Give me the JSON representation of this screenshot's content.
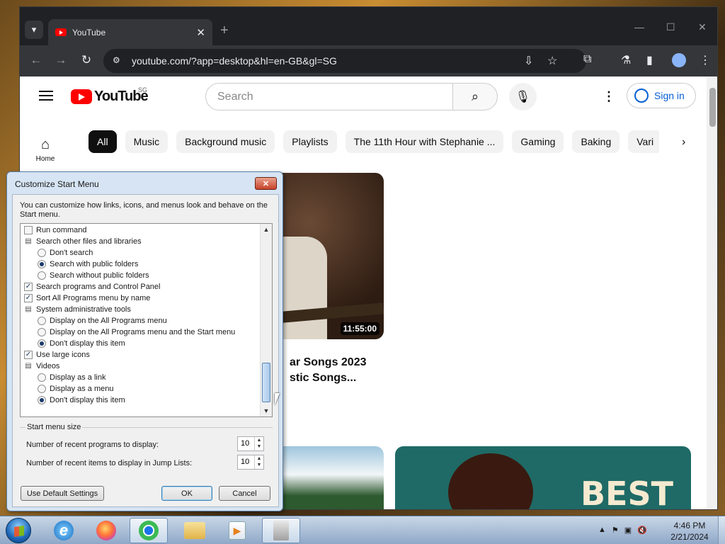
{
  "browser": {
    "tab_title": "YouTube",
    "url": "youtube.com/?app=desktop&hl=en-GB&gl=SG"
  },
  "youtube": {
    "logo_text": "YouTube",
    "region": "SG",
    "search_placeholder": "Search",
    "signin_label": "Sign in",
    "home_label": "Home",
    "chips": [
      "All",
      "Music",
      "Background music",
      "Playlists",
      "The 11th Hour with Stephanie ...",
      "Gaming",
      "Baking",
      "Vari"
    ],
    "video1_duration": "11:55:00",
    "video1_title_line1": "ar Songs 2023",
    "video1_title_line2": "stic Songs...",
    "thumb3_text": "BEST"
  },
  "dialog": {
    "title": "Customize Start Menu",
    "intro": "You can customize how links, icons, and menus look and behave on the Start menu.",
    "options": [
      {
        "kind": "checkbox",
        "checked": false,
        "indent": 0,
        "label": "Run command"
      },
      {
        "kind": "group",
        "indent": 0,
        "label": "Search other files and libraries"
      },
      {
        "kind": "radio",
        "checked": false,
        "indent": 1,
        "label": "Don't search"
      },
      {
        "kind": "radio",
        "checked": true,
        "indent": 1,
        "label": "Search with public folders"
      },
      {
        "kind": "radio",
        "checked": false,
        "indent": 1,
        "label": "Search without public folders"
      },
      {
        "kind": "checkbox",
        "checked": true,
        "indent": 0,
        "label": "Search programs and Control Panel"
      },
      {
        "kind": "checkbox",
        "checked": true,
        "indent": 0,
        "label": "Sort All Programs menu by name"
      },
      {
        "kind": "group",
        "indent": 0,
        "label": "System administrative tools"
      },
      {
        "kind": "radio",
        "checked": false,
        "indent": 1,
        "label": "Display on the All Programs menu"
      },
      {
        "kind": "radio",
        "checked": false,
        "indent": 1,
        "label": "Display on the All Programs menu and the Start menu"
      },
      {
        "kind": "radio",
        "checked": true,
        "indent": 1,
        "label": "Don't display this item"
      },
      {
        "kind": "checkbox",
        "checked": true,
        "indent": 0,
        "label": "Use large icons"
      },
      {
        "kind": "group",
        "indent": 0,
        "label": "Videos"
      },
      {
        "kind": "radio",
        "checked": false,
        "indent": 1,
        "label": "Display as a link"
      },
      {
        "kind": "radio",
        "checked": false,
        "indent": 1,
        "label": "Display as a menu"
      },
      {
        "kind": "radio",
        "checked": true,
        "indent": 1,
        "label": "Don't display this item"
      }
    ],
    "size_group_label": "Start menu size",
    "recent_programs_label": "Number of recent programs to display:",
    "recent_programs_value": "10",
    "recent_items_label": "Number of recent items to display in Jump Lists:",
    "recent_items_value": "10",
    "default_button": "Use Default Settings",
    "ok_button": "OK",
    "cancel_button": "Cancel"
  },
  "taskbar": {
    "time": "4:46 PM",
    "date": "2/21/2024",
    "apps": [
      "internet-explorer",
      "firefox",
      "chrome",
      "file-explorer",
      "media-player",
      "control-panel"
    ]
  }
}
